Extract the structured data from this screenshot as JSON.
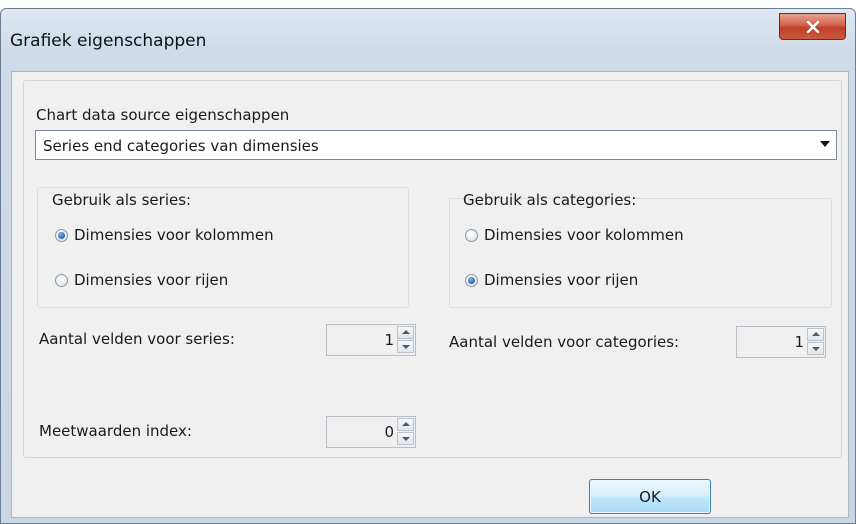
{
  "window": {
    "title": "Grafiek eigenschappen",
    "close_label": "X"
  },
  "source": {
    "label": "Chart data source eigenschappen",
    "selected": "Series end categories van dimensies"
  },
  "series_group": {
    "title": "Gebruik als series:",
    "options": [
      "Dimensies voor kolommen",
      "Dimensies voor rijen"
    ],
    "selected_index": 0
  },
  "categories_group": {
    "title": "Gebruik als categories:",
    "options": [
      "Dimensies voor kolommen",
      "Dimensies voor rijen"
    ],
    "selected_index": 1
  },
  "fields": {
    "series_label": "Aantal velden voor series:",
    "series_value": "1",
    "categories_label": "Aantal velden voor categories:",
    "categories_value": "1",
    "measure_label": "Meetwaarden index:",
    "measure_value": "0"
  },
  "buttons": {
    "ok": "OK"
  },
  "icons": {
    "close": "close-icon",
    "dropdown": "chevron-down-icon",
    "spin_up": "spin-up-icon",
    "spin_down": "spin-down-icon"
  }
}
